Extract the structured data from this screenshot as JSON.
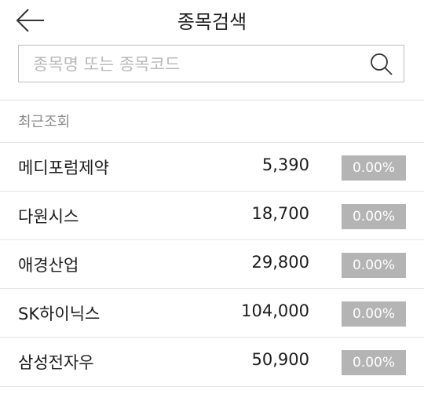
{
  "header": {
    "title": "종목검색",
    "back_icon": "arrow-left-icon"
  },
  "search": {
    "placeholder": "종목명 또는 종목코드",
    "value": "",
    "icon": "search-icon"
  },
  "recent": {
    "label": "최근조회",
    "items": [
      {
        "name": "메디포럼제약",
        "price": "5,390",
        "change": "0.00%"
      },
      {
        "name": "다원시스",
        "price": "18,700",
        "change": "0.00%"
      },
      {
        "name": "애경산업",
        "price": "29,800",
        "change": "0.00%"
      },
      {
        "name": "SK하이닉스",
        "price": "104,000",
        "change": "0.00%"
      },
      {
        "name": "삼성전자우",
        "price": "50,900",
        "change": "0.00%"
      }
    ]
  },
  "colors": {
    "change_badge_bg": "#b4b4b4",
    "change_badge_text": "#ffffff",
    "divider": "#e6e6e6",
    "section_label": "#8a8a8a"
  }
}
